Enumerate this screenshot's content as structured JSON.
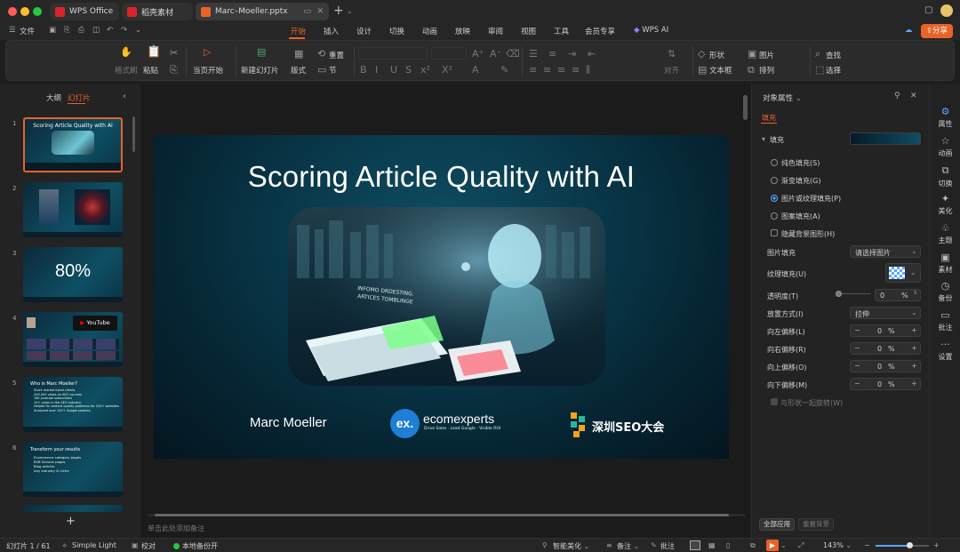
{
  "titlebar": {
    "tabs": [
      {
        "label": "WPS Office",
        "color": "#d7262b"
      },
      {
        "label": "稻壳素材",
        "color": "#d7262b"
      },
      {
        "label": "Marc–Moeller.pptx",
        "color": "#e8632a"
      }
    ],
    "traffic": [
      "#ff5f57",
      "#febc2e",
      "#28c840"
    ]
  },
  "menu": {
    "file": "文件",
    "tabs": [
      "开始",
      "插入",
      "设计",
      "切换",
      "动画",
      "放映",
      "审阅",
      "视图",
      "工具",
      "会员专享"
    ],
    "wps_ai": "WPS AI",
    "share": "分享",
    "accent": "#e8632a"
  },
  "ribbon": {
    "format_painter": "格式刷",
    "paste": "粘贴",
    "start_from_current": "当页开始",
    "new_slide": "新建幻灯片",
    "layout": "版式",
    "reset": "重置",
    "section": "节",
    "align": "对齐",
    "shape": "形状",
    "picture": "图片",
    "textbox": "文本框",
    "arrange": "排列",
    "find": "查找",
    "select": "选择"
  },
  "left_panel": {
    "outline_tab": "大纲",
    "slides_tab": "幻灯片",
    "thumbs": [
      {
        "num": "1",
        "title": "Scoring Article Quality with AI"
      },
      {
        "num": "2",
        "title": ""
      },
      {
        "num": "3",
        "title": "80%"
      },
      {
        "num": "4",
        "title": "YouTube"
      },
      {
        "num": "5",
        "title": "Who is Marc Moeller?",
        "lines": [
          "Stock market listed clients",
          "200,000 views on SEO courses",
          "18k youtube subscribers",
          "10+ years in the SEO industry",
          "Helped fix content quality problems for 100+ websites",
          "Analysed over 100+ Google patents"
        ]
      },
      {
        "num": "6",
        "title": "Transform your results",
        "lines": [
          "Ecommerce category pages",
          "B2B Service pages",
          "Blog articles",
          "Any industry & niche"
        ]
      }
    ]
  },
  "slide": {
    "title": "Scoring Article Quality with AI",
    "author": "Marc Moeller",
    "logo_name": "ecomexperts",
    "logo_mark": "ex.",
    "logo_tagline": "Drive Sales · Lead Google · Visible ROI",
    "event_name": "深圳SEO大会",
    "paper_text_1": "INFOMO DRDESTING.",
    "paper_text_2": "ARTICES TOMBLINGE"
  },
  "notes_placeholder": "单击此处添加备注",
  "properties": {
    "header": "对象属性",
    "tab": "填充",
    "section": "填充",
    "options": [
      "纯色填充(S)",
      "渐变填充(G)",
      "图片或纹理填充(P)",
      "图案填充(A)"
    ],
    "selected_option": 2,
    "hide_bg": "隐藏背景图形(H)",
    "picture_fill_label": "图片填充",
    "picture_fill_value": "请选择图片",
    "texture_label": "纹理填充(U)",
    "transparency_label": "透明度(T)",
    "transparency_value": "0",
    "percent": "%",
    "placement_label": "放置方式(I)",
    "placement_value": "拉伸",
    "offsets": [
      {
        "label": "向左偏移(L)",
        "value": "0"
      },
      {
        "label": "向右偏移(R)",
        "value": "0"
      },
      {
        "label": "向上偏移(O)",
        "value": "0"
      },
      {
        "label": "向下偏移(M)",
        "value": "0"
      }
    ],
    "rotate_with_shape": "与形状一起旋转(W)",
    "apply_all": "全部应用",
    "reset_bg": "重置背景"
  },
  "right_bar": [
    "属性",
    "动画",
    "切换",
    "美化",
    "主题",
    "素材",
    "备份",
    "批注",
    "设置"
  ],
  "status": {
    "slide_counter": "幻灯片 1 / 61",
    "theme": "Simple Light",
    "proofread": "校对",
    "backup": "本地备份开",
    "smart_beautify": "智能美化",
    "notes": "备注",
    "comments": "批注",
    "zoom": "143%"
  }
}
